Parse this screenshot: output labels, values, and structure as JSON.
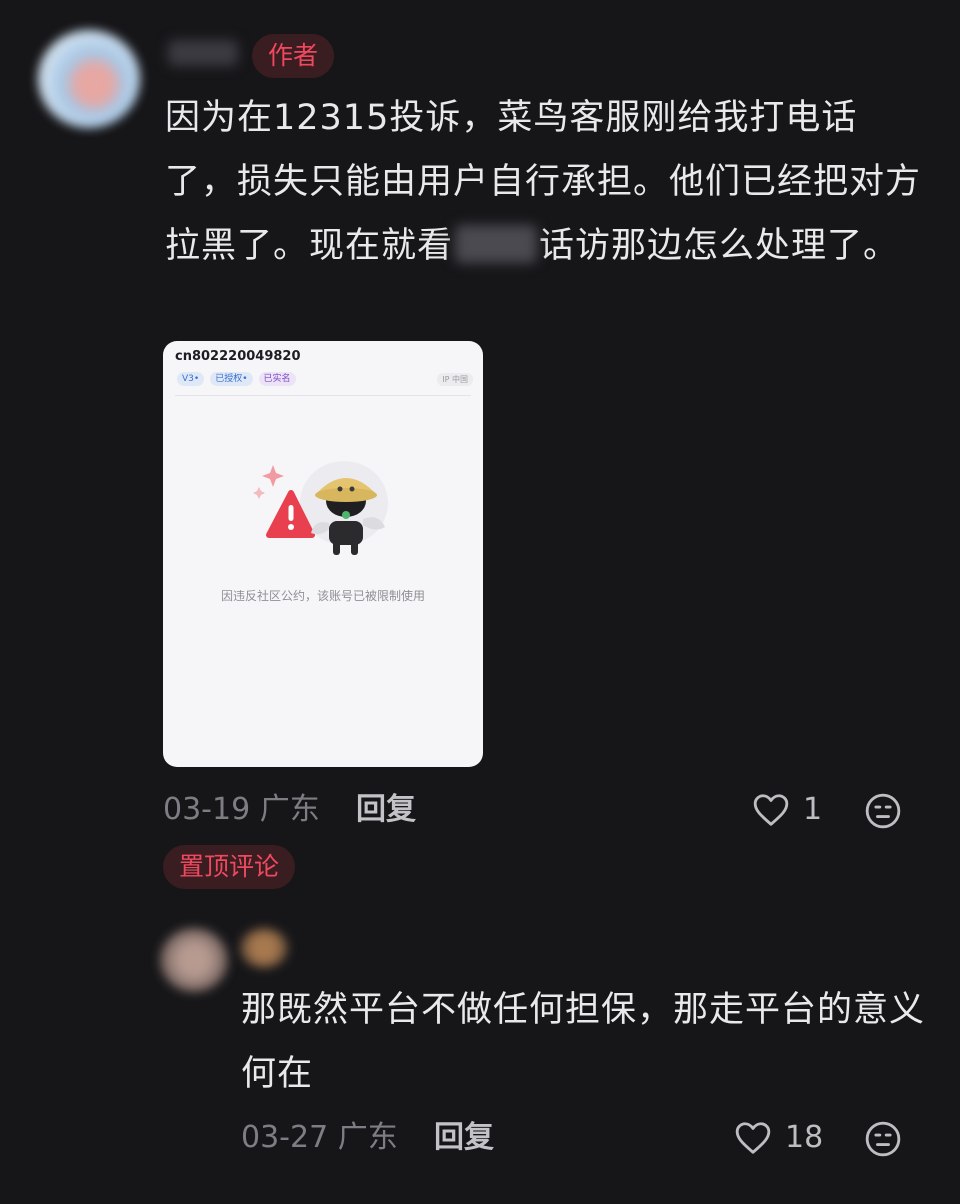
{
  "comment_1": {
    "badge": "作者",
    "text_part1": "因为在12315投诉，菜鸟客服刚给我打电话了，损失只能由用户自行承担。他们已经把对方拉黑了。现在就看",
    "text_part2": "话访那边怎么处理了。",
    "screenshot": {
      "account": "cn802220049820",
      "tags": [
        "V3•",
        "已授权•",
        "已实名"
      ],
      "ip": "IP 中国",
      "notice": "因违反社区公约，该账号已被限制使用"
    },
    "date": "03-19",
    "location": "广东",
    "reply_label": "回复",
    "likes": "1"
  },
  "pinned_label": "置顶评论",
  "comment_2": {
    "text": "那既然平台不做任何担保，那走平台的意义何在",
    "date": "03-27",
    "location": "广东",
    "reply_label": "回复",
    "likes": "18"
  },
  "icons": [
    "heart-icon",
    "emoji-icon",
    "warning-icon",
    "mascot-illustration"
  ],
  "colors": {
    "background": "#161619",
    "badge_red": "#f0495f",
    "text": "#e9e9ec",
    "muted": "#7d7d84"
  }
}
